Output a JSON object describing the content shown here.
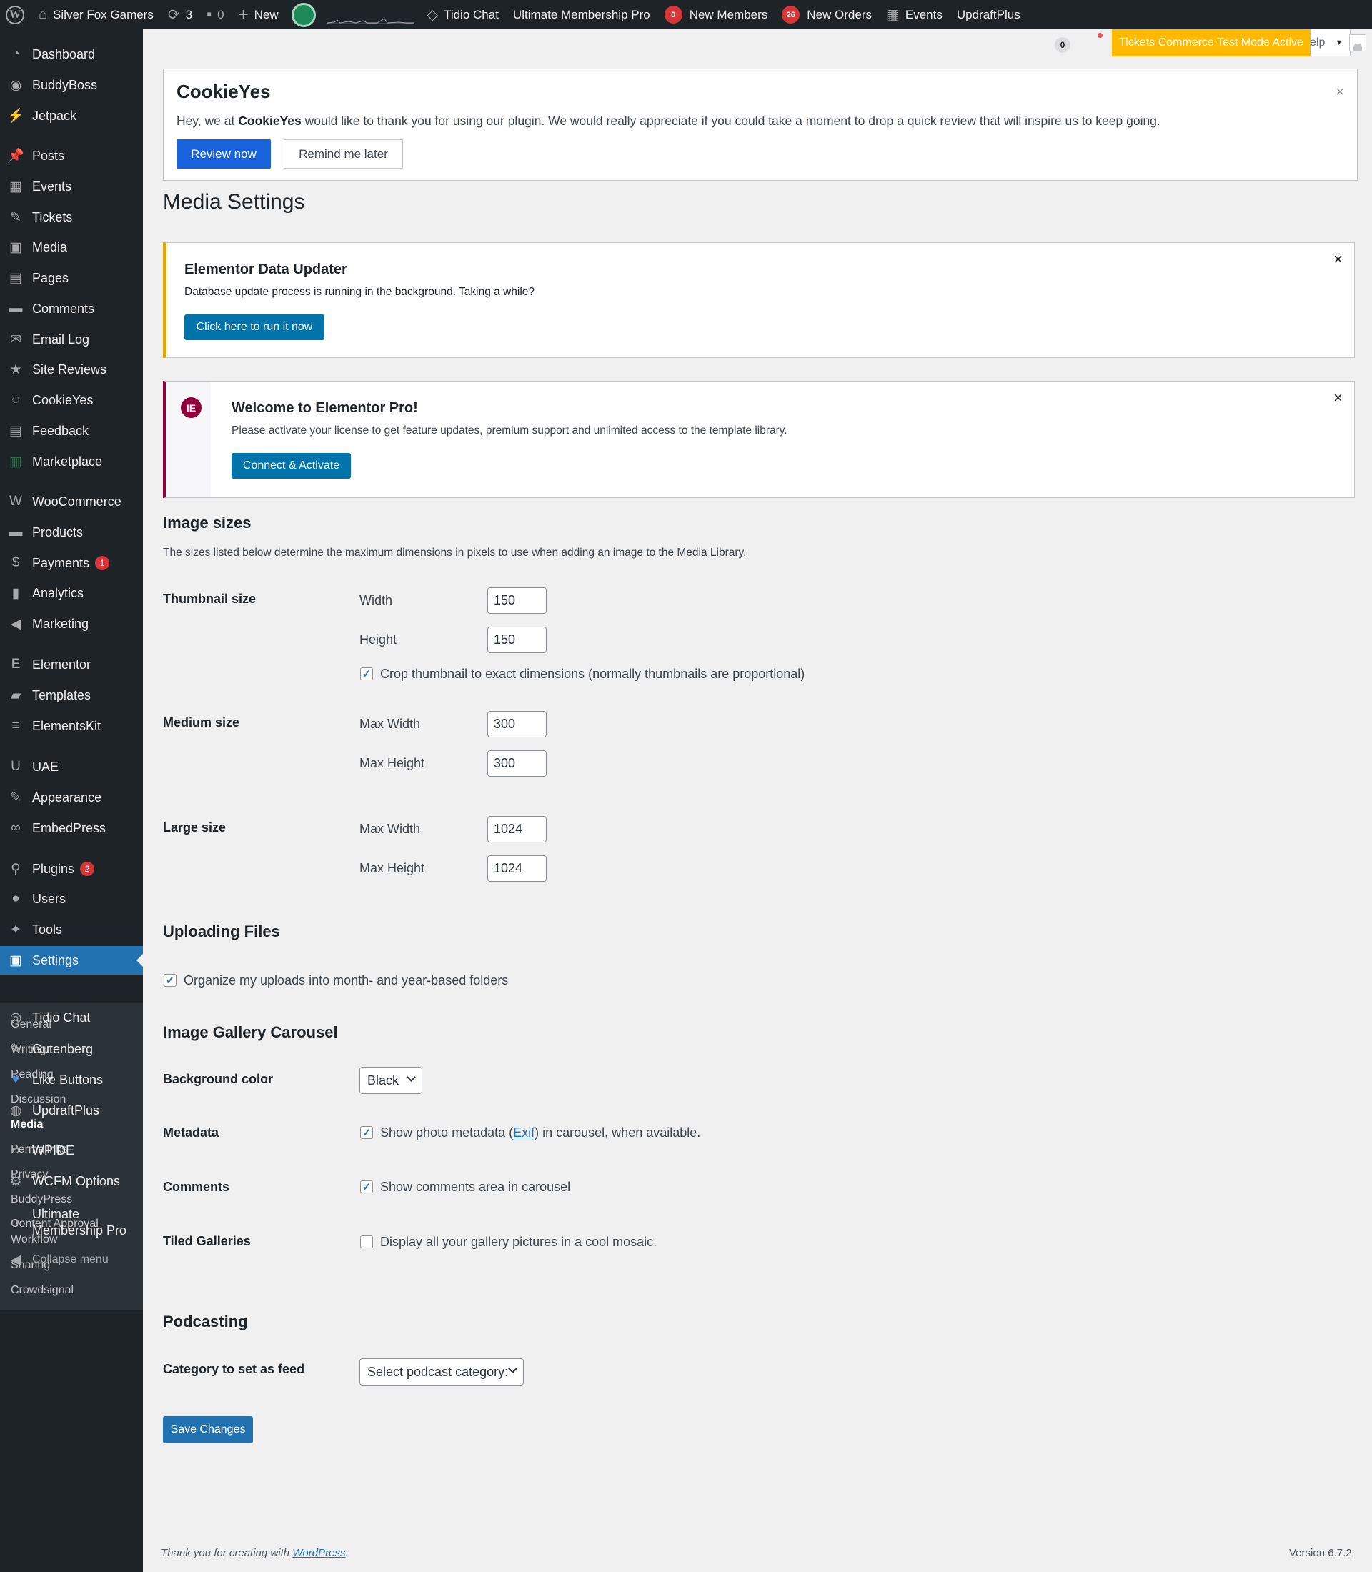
{
  "adminbar": {
    "site_name": "Silver Fox Gamers",
    "updates_count": "3",
    "comments_count": "0",
    "new_label": "New",
    "tidio": "Tidio Chat",
    "ump": "Ultimate Membership Pro",
    "new_members_count": "0",
    "new_members": "New Members",
    "new_orders_count": "26",
    "new_orders": "New Orders",
    "events": "Events",
    "updraft": "UpdraftPlus"
  },
  "topstrip": {
    "count": "0",
    "tickets_banner": "Tickets Commerce Test Mode Active",
    "help": "elp"
  },
  "sidebar": {
    "items": [
      {
        "label": "Dashboard",
        "icon": "dashboard-icon"
      },
      {
        "label": "BuddyBoss",
        "icon": "buddyboss-icon"
      },
      {
        "label": "Jetpack",
        "icon": "jetpack-icon"
      },
      {
        "label": "Posts",
        "icon": "pin-icon"
      },
      {
        "label": "Events",
        "icon": "events-icon"
      },
      {
        "label": "Tickets",
        "icon": "tickets-icon"
      },
      {
        "label": "Media",
        "icon": "media-icon"
      },
      {
        "label": "Pages",
        "icon": "pages-icon"
      },
      {
        "label": "Comments",
        "icon": "comments-icon"
      },
      {
        "label": "Email Log",
        "icon": "email-icon"
      },
      {
        "label": "Site Reviews",
        "icon": "star-icon"
      },
      {
        "label": "CookieYes",
        "icon": "cookieyes-icon"
      },
      {
        "label": "Feedback",
        "icon": "feedback-icon"
      },
      {
        "label": "Marketplace",
        "icon": "marketplace-icon"
      },
      {
        "label": "WooCommerce",
        "icon": "woocommerce-icon"
      },
      {
        "label": "Products",
        "icon": "products-icon"
      },
      {
        "label": "Payments",
        "icon": "payments-icon",
        "badge": "1"
      },
      {
        "label": "Analytics",
        "icon": "analytics-icon"
      },
      {
        "label": "Marketing",
        "icon": "megaphone-icon"
      },
      {
        "label": "Elementor",
        "icon": "elementor-icon"
      },
      {
        "label": "Templates",
        "icon": "folder-icon"
      },
      {
        "label": "ElementsKit",
        "icon": "elementskit-icon"
      },
      {
        "label": "UAE",
        "icon": "uae-icon"
      },
      {
        "label": "Appearance",
        "icon": "brush-icon"
      },
      {
        "label": "EmbedPress",
        "icon": "embedpress-icon"
      },
      {
        "label": "Plugins",
        "icon": "plugins-icon",
        "badge": "2"
      },
      {
        "label": "Users",
        "icon": "users-icon"
      },
      {
        "label": "Tools",
        "icon": "wrench-icon"
      },
      {
        "label": "Settings",
        "icon": "settings-icon"
      },
      {
        "label": "Tidio Chat",
        "icon": "tidio-icon"
      },
      {
        "label": "Gutenberg",
        "icon": "gutenberg-icon"
      },
      {
        "label": "Like Buttons",
        "icon": "heart-icon"
      },
      {
        "label": "UpdraftPlus",
        "icon": "updraft-icon"
      },
      {
        "label": "WPIDE",
        "icon": "code-icon"
      },
      {
        "label": "WCFM Options",
        "icon": "gear-icon"
      },
      {
        "label": "Ultimate Membership Pro",
        "icon": "membership-icon"
      },
      {
        "label": "Collapse menu",
        "icon": "collapse-icon"
      }
    ],
    "submenu": [
      "General",
      "Writing",
      "Reading",
      "Discussion",
      "Media",
      "Permalinks",
      "Privacy",
      "BuddyPress",
      "Content Approval Workflow",
      "Sharing",
      "Crowdsignal"
    ]
  },
  "cookieyes": {
    "brand": "CookieYes",
    "text_pre": "Hey, we at ",
    "text_brand": "CookieYes",
    "text_post": " would like to thank you for using our plugin. We would really appreciate if you could take a moment to drop a quick review that will inspire us to keep going.",
    "review": "Review now",
    "remind": "Remind me later"
  },
  "page_title": "Media Settings",
  "elementor_updater": {
    "title": "Elementor Data Updater",
    "text": "Database update process is running in the background. Taking a while?",
    "button": "Click here to run it now"
  },
  "elementor_pro": {
    "title": "Welcome to Elementor Pro!",
    "text": "Please activate your license to get feature updates, premium support and unlimited access to the template library.",
    "button": "Connect & Activate"
  },
  "image_sizes": {
    "title": "Image sizes",
    "desc": "The sizes listed below determine the maximum dimensions in pixels to use when adding an image to the Media Library.",
    "thumbnail": {
      "label": "Thumbnail size",
      "width_label": "Width",
      "width": "150",
      "height_label": "Height",
      "height": "150",
      "crop_label": "Crop thumbnail to exact dimensions (normally thumbnails are proportional)",
      "crop_checked": true
    },
    "medium": {
      "label": "Medium size",
      "width_label": "Max Width",
      "width": "300",
      "height_label": "Max Height",
      "height": "300"
    },
    "large": {
      "label": "Large size",
      "width_label": "Max Width",
      "width": "1024",
      "height_label": "Max Height",
      "height": "1024"
    }
  },
  "uploading": {
    "title": "Uploading Files",
    "organize_label": "Organize my uploads into month- and year-based folders",
    "organize_checked": true
  },
  "carousel": {
    "title": "Image Gallery Carousel",
    "bg_label": "Background color",
    "bg_value": "Black",
    "metadata_label": "Metadata",
    "metadata_pre": "Show photo metadata (",
    "metadata_link": "Exif",
    "metadata_post": ") in carousel, when available.",
    "metadata_checked": true,
    "comments_label": "Comments",
    "comments_text": "Show comments area in carousel",
    "comments_checked": true,
    "tiled_label": "Tiled Galleries",
    "tiled_text": "Display all your gallery pictures in a cool mosaic.",
    "tiled_checked": false
  },
  "podcasting": {
    "title": "Podcasting",
    "category_label": "Category to set as feed",
    "category_value": "Select podcast category:"
  },
  "save": "Save Changes",
  "footer": {
    "thanks_pre": "Thank you for creating with ",
    "thanks_link": "WordPress",
    "thanks_post": ".",
    "version": "Version 6.7.2"
  },
  "colors": {
    "admin_dark": "#1d2327",
    "accent": "#2271b1",
    "warning": "#dba617",
    "elementor": "#92003b",
    "tickets_banner": "#ffb900"
  }
}
